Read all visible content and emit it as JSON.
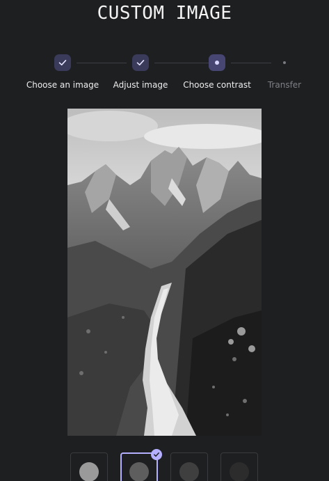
{
  "header": {
    "title": "CUSTOM IMAGE"
  },
  "stepper": {
    "steps": [
      {
        "label": "Choose an image",
        "state": "done"
      },
      {
        "label": "Adjust image",
        "state": "done"
      },
      {
        "label": "Choose contrast",
        "state": "current"
      },
      {
        "label": "Transfer",
        "state": "pending"
      }
    ]
  },
  "preview": {
    "image": "grayscale mountain trail photo"
  },
  "contrast_options": [
    {
      "swatch": "#9a9a9a",
      "selected": false
    },
    {
      "swatch": "#5e5e5e",
      "selected": true
    },
    {
      "swatch": "#3f3f3f",
      "selected": false
    },
    {
      "swatch": "#2c2c2c",
      "selected": false
    }
  ],
  "colors": {
    "background": "#1e1f21",
    "accent": "#b5b0ff",
    "step_done_bg": "#3a3a5a"
  }
}
